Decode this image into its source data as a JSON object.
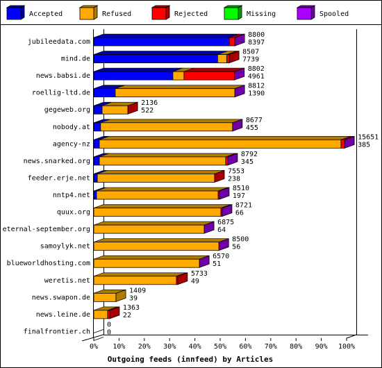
{
  "chart_data": {
    "type": "bar",
    "orientation": "horizontal",
    "stacked": true,
    "style": "3d",
    "title": "",
    "xlabel": "Outgoing feeds (innfeed) by Articles",
    "ylabel": "",
    "xlim": [
      0,
      100
    ],
    "x_unit": "percent",
    "x_ticks": [
      "0%",
      "10%",
      "20%",
      "30%",
      "40%",
      "50%",
      "60%",
      "70%",
      "80%",
      "90%",
      "100%"
    ],
    "legend_position": "top",
    "legend": [
      {
        "name": "Accepted",
        "color": "#0000ff"
      },
      {
        "name": "Refused",
        "color": "#ffaa00"
      },
      {
        "name": "Rejected",
        "color": "#ff0000"
      },
      {
        "name": "Missing",
        "color": "#00ff00"
      },
      {
        "name": "Spooled",
        "color": "#aa00ff"
      }
    ],
    "categories": [
      "jubileedata.com",
      "mind.de",
      "news.babsi.de",
      "roellig-ltd.de",
      "gegeweb.org",
      "nobody.at",
      "agency-nz",
      "news.snarked.org",
      "feeder.erje.net",
      "nntp4.net",
      "quux.org",
      "eternal-september.org",
      "samoylyk.net",
      "blueworldhosting.com",
      "weretis.net",
      "news.swapon.de",
      "news.leine.de",
      "finalfrontier.ch"
    ],
    "series": [
      {
        "name": "Accepted",
        "values": [
          53.6,
          49.0,
          31.3,
          8.5,
          3.3,
          2.7,
          2.2,
          2.2,
          1.4,
          1.1,
          0,
          0,
          0,
          0,
          0,
          0,
          0,
          0
        ]
      },
      {
        "name": "Refused",
        "values": [
          0,
          3.6,
          4.4,
          47.3,
          10.2,
          52.2,
          95.6,
          50.0,
          46.4,
          48.1,
          50.3,
          43.7,
          49.5,
          41.8,
          32.7,
          8.8,
          5.5,
          0
        ]
      },
      {
        "name": "Rejected",
        "values": [
          2.2,
          1.0,
          20.0,
          0,
          0,
          0,
          1.4,
          0.8,
          0,
          0.5,
          0.5,
          0,
          0,
          0,
          0.5,
          0,
          0.8,
          0
        ]
      },
      {
        "name": "Missing",
        "values": [
          0,
          0,
          0,
          0,
          0,
          0,
          0,
          0,
          0,
          0,
          0,
          0,
          0,
          0,
          0,
          0,
          0,
          0
        ]
      },
      {
        "name": "Spooled",
        "values": [
          0,
          0,
          0,
          0,
          0,
          0,
          0,
          0,
          0,
          0,
          0,
          0,
          0,
          0,
          0,
          0,
          0,
          0
        ]
      }
    ],
    "end_cap_color_series": [
      "Spooled",
      "Rejected",
      "Spooled",
      "Spooled",
      "Rejected",
      "Spooled",
      "Spooled",
      "Spooled",
      "Rejected",
      "Spooled",
      "Spooled",
      "Spooled",
      "Spooled",
      "Spooled",
      "Rejected",
      "Refused",
      "Rejected",
      "none"
    ],
    "annotations": [
      {
        "category": "jubileedata.com",
        "top": "8800",
        "bottom": "8397"
      },
      {
        "category": "mind.de",
        "top": "8507",
        "bottom": "7739"
      },
      {
        "category": "news.babsi.de",
        "top": "8802",
        "bottom": "4961"
      },
      {
        "category": "roellig-ltd.de",
        "top": "8812",
        "bottom": "1390"
      },
      {
        "category": "gegeweb.org",
        "top": "2136",
        "bottom": "522"
      },
      {
        "category": "nobody.at",
        "top": "8677",
        "bottom": "455"
      },
      {
        "category": "agency-nz",
        "top": "15651",
        "bottom": "385"
      },
      {
        "category": "news.snarked.org",
        "top": "8792",
        "bottom": "345"
      },
      {
        "category": "feeder.erje.net",
        "top": "7553",
        "bottom": "238"
      },
      {
        "category": "nntp4.net",
        "top": "8510",
        "bottom": "197"
      },
      {
        "category": "quux.org",
        "top": "8721",
        "bottom": "66"
      },
      {
        "category": "eternal-september.org",
        "top": "6875",
        "bottom": "64"
      },
      {
        "category": "samoylyk.net",
        "top": "8500",
        "bottom": "56"
      },
      {
        "category": "blueworldhosting.com",
        "top": "6570",
        "bottom": "51"
      },
      {
        "category": "weretis.net",
        "top": "5733",
        "bottom": "49"
      },
      {
        "category": "news.swapon.de",
        "top": "1409",
        "bottom": "39"
      },
      {
        "category": "news.leine.de",
        "top": "1363",
        "bottom": "22"
      },
      {
        "category": "finalfrontier.ch",
        "top": "0",
        "bottom": "0"
      }
    ],
    "grid": false
  }
}
